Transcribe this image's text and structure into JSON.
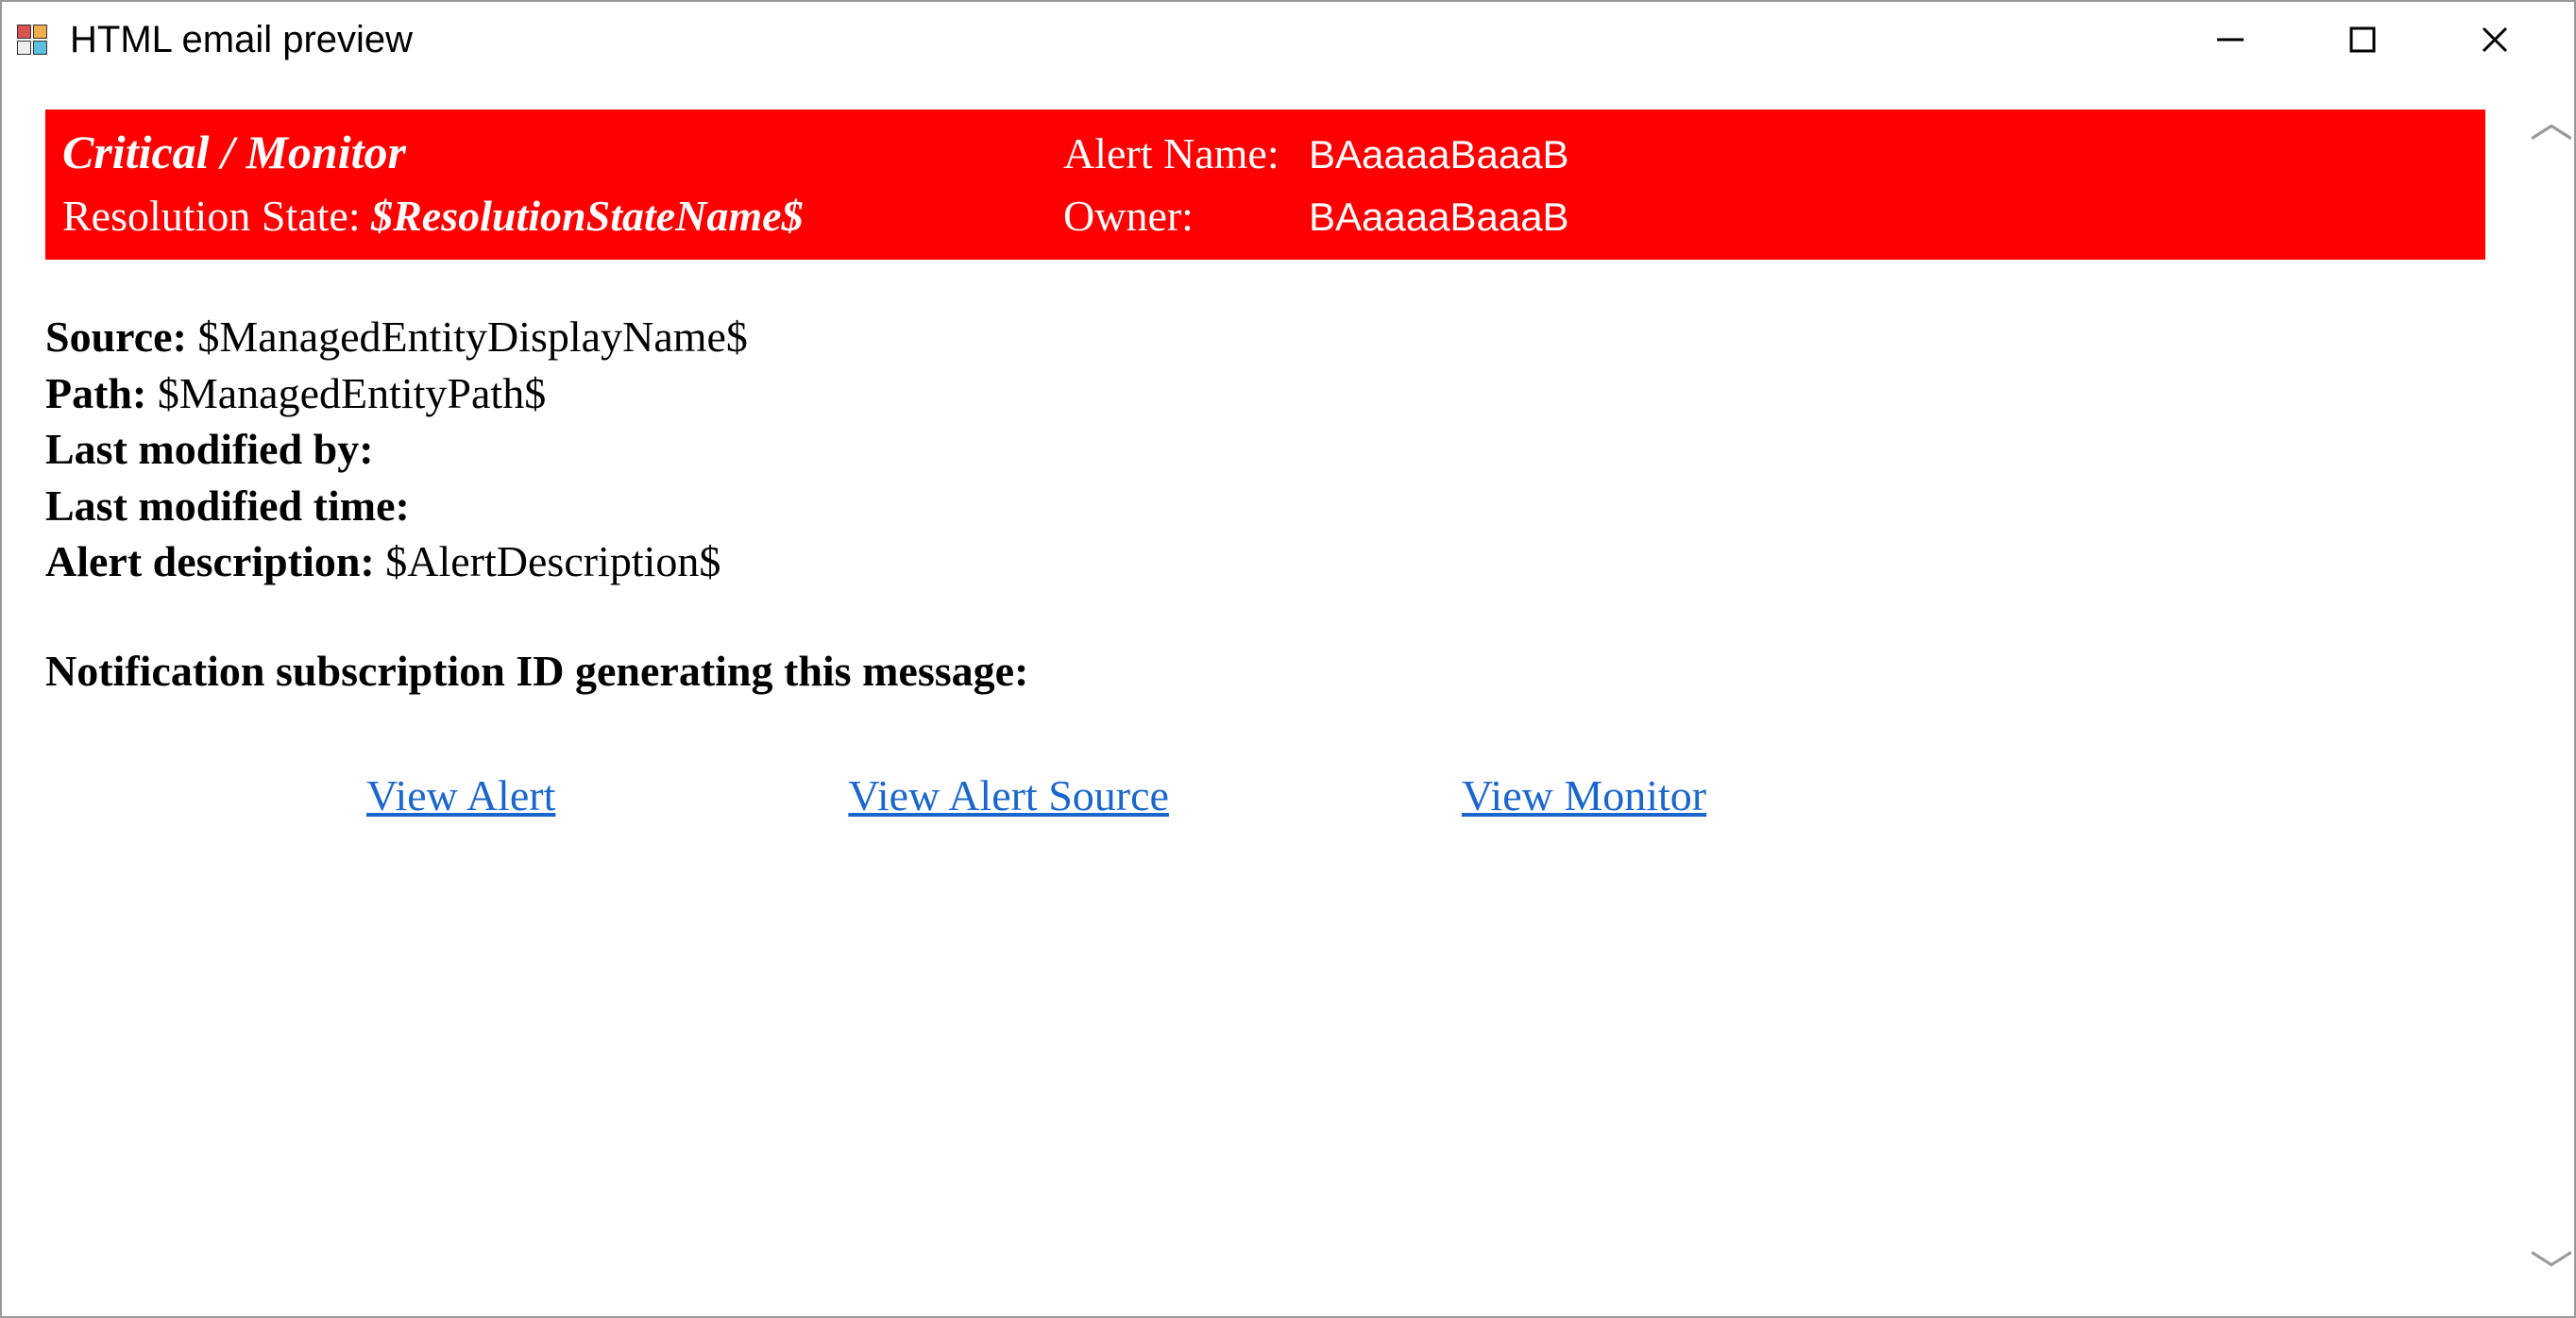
{
  "window": {
    "title": "HTML email preview"
  },
  "header": {
    "severity_source": "Critical / Monitor",
    "alert_name_label": "Alert Name:",
    "alert_name_value": "BAaaaaBaaaB",
    "resolution_state_label": "Resolution State:",
    "resolution_state_value": "$ResolutionStateName$",
    "owner_label": "Owner:",
    "owner_value": "BAaaaaBaaaB"
  },
  "details": {
    "source_label": "Source:",
    "source_value": "$ManagedEntityDisplayName$",
    "path_label": "Path:",
    "path_value": "$ManagedEntityPath$",
    "last_modified_by_label": "Last modified by:",
    "last_modified_by_value": "",
    "last_modified_time_label": "Last modified time:",
    "last_modified_time_value": "",
    "alert_description_label": "Alert description:",
    "alert_description_value": "$AlertDescription$",
    "subscription_label": "Notification subscription ID generating this message:",
    "subscription_value": ""
  },
  "links": {
    "view_alert": "View Alert",
    "view_alert_source": "View Alert Source",
    "view_monitor": "View Monitor"
  }
}
